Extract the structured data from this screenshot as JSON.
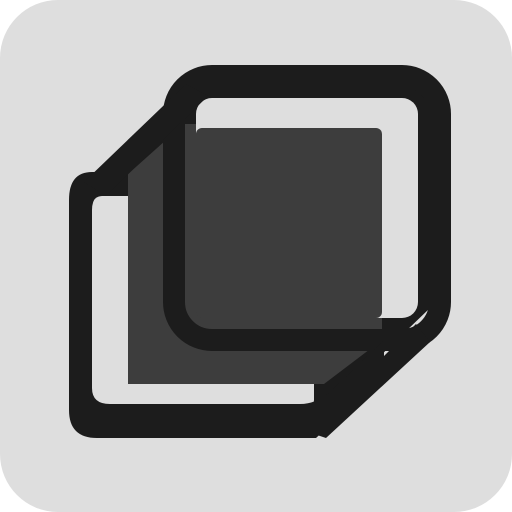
{
  "icon": {
    "name": "stacked-squares-icon",
    "background_color": "#dedede",
    "outline_color": "#1c1c1c",
    "fill_color": "#3d3d3d",
    "inner_color": "#dedede"
  }
}
